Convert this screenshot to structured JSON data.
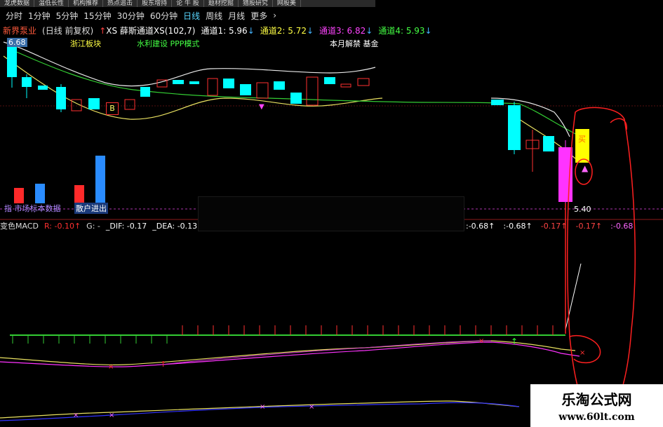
{
  "top_menu": [
    "龙虎数据",
    "温低长性",
    "机构推荐",
    "热点追击",
    "股东增持",
    "论 牛 股",
    "题材挖掘",
    "猎股研究",
    "网股美"
  ],
  "periods": {
    "items": [
      "分时",
      "1分钟",
      "5分钟",
      "15分钟",
      "30分钟",
      "60分钟",
      "日线",
      "周线",
      "月线",
      "更多"
    ],
    "active": "日线",
    "more_arrow": "›"
  },
  "stock": {
    "name": "新界泵业",
    "mode": "(日线 前复权)",
    "indicator": "XS 薛斯通道XS(102,7)",
    "channel1_label": "通道1: 5.96",
    "channel2_label": "通道2: 5.72",
    "channel3_label": "通道3: 6.82",
    "channel4_label": "通道4: 5.93",
    "down_arrow": "↓",
    "up_arrow": "↑",
    "top_price": "6.68",
    "tag_sector": "浙江板块",
    "tag_concept": "水利建设 PPP模式",
    "tag_note": "本月解禁 基金"
  },
  "price_chart": {
    "low_label": "5.40",
    "b_marker": "B",
    "buy_marker": "买",
    "colors": {
      "up": "#ff3030",
      "down": "#00ffff",
      "ma_white": "#e8e8e8",
      "ma_green": "#33cc33",
      "ma_yellow": "#e8e060",
      "magenta": "#ff33ff"
    }
  },
  "volume": {
    "legend_left": "指 市场标本数据",
    "legend_right": "散户进出"
  },
  "macd": {
    "title": "变色MACD",
    "r_label": "R: -0.10",
    "g_label": "G: -",
    "dif_label": "_DIF: -0.17",
    "dea_label": "_DEA: -0.13",
    "right_values": [
      ":-0.68",
      ":-0.68",
      "-0.17",
      "-0.17",
      ":-0.68"
    ]
  },
  "watermark": {
    "title": "乐淘公式网",
    "url": "www.60lt.com"
  }
}
